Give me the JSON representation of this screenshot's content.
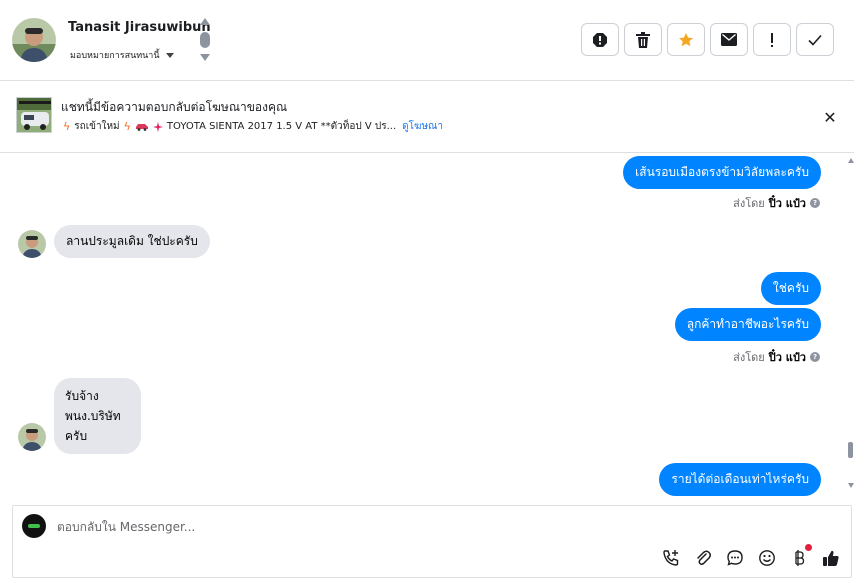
{
  "header": {
    "contact_name": "Tanasit Jirasuwibun",
    "assign_label": "มอบหมายการสนทนานี้",
    "actions": [
      {
        "name": "report-spam",
        "icon": "alert-circle-icon"
      },
      {
        "name": "delete",
        "icon": "trash-icon"
      },
      {
        "name": "star",
        "icon": "star-icon"
      },
      {
        "name": "mark-unread",
        "icon": "envelope-icon"
      },
      {
        "name": "follow-up",
        "icon": "exclamation-icon"
      },
      {
        "name": "mark-done",
        "icon": "checkmark-icon"
      }
    ]
  },
  "ad": {
    "title": "แชทนี้มีข้อความตอบกลับต่อโฆษณาของคุณ",
    "subtitle_prefix": "รถเข้าใหม่",
    "subtitle_text": "TOYOTA SIENTA 2017 1.5 V AT **ตัวท็อป V ปร...",
    "link": "ดูโฆษณา"
  },
  "messages": {
    "out_1": "เส้นรอบเมืองตรงข้ามวิลัยพละครับ",
    "sent_by_1": {
      "prefix": "ส่งโดย",
      "name": "ปิ๋ว แป๋ว"
    },
    "in_1": "ลานประมูลเดิม ใช่ปะครับ",
    "out_2": "ใช่ครับ",
    "out_3": "ลูกค้าทำอาชีพอะไรครับ",
    "sent_by_2": {
      "prefix": "ส่งโดย",
      "name": "ปิ๋ว แป๋ว"
    },
    "in_2_lines": [
      "รับจ้าง",
      "พนง.บริษัท",
      "ครับ"
    ],
    "out_4": "รายได้ต่อเดือนเท่าไหร่ครับ"
  },
  "composer": {
    "placeholder": "ตอบกลับใน Messenger..."
  },
  "colors": {
    "messenger_blue": "#0084ff",
    "incoming_gray": "#e4e6eb",
    "star_orange": "#f5a623",
    "link_blue": "#1877f2"
  }
}
